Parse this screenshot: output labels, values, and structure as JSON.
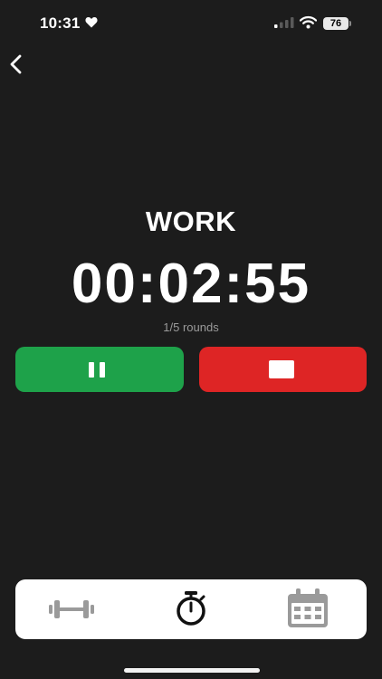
{
  "status_bar": {
    "time": "10:31",
    "battery": "76"
  },
  "workout": {
    "phase": "WORK",
    "timer": "00:02:55",
    "rounds": "1/5 rounds"
  },
  "tabs": [
    {
      "icon": "dumbbell-icon",
      "active": false
    },
    {
      "icon": "stopwatch-icon",
      "active": true
    },
    {
      "icon": "calendar-icon",
      "active": false
    }
  ],
  "colors": {
    "background": "#1c1c1c",
    "pause": "#1ea24a",
    "stop": "#de2525",
    "tabbar": "#ffffff",
    "inactive_icon": "#9a9a9a"
  }
}
